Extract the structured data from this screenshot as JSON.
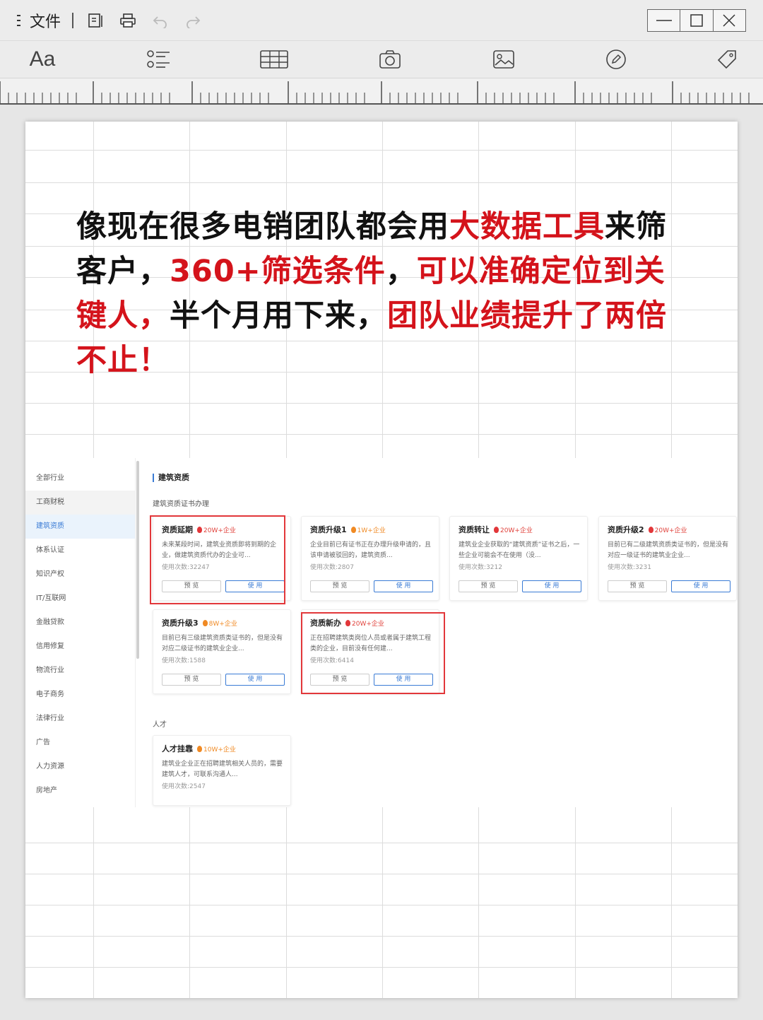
{
  "titlebar": {
    "menu_label": "文件"
  },
  "headline": {
    "l1a": "像现在很多电销团队都会用",
    "l1b": "大数据工具",
    "l1c": "来筛",
    "l2a": "客户，",
    "l2b": "360+筛选条件",
    "l2c": "，",
    "l2d": "可以准确定位到关",
    "l3a": "键人，",
    "l3b": "半个月用下来，",
    "l3c": "团队业绩提升了两倍",
    "l4a": "不止！"
  },
  "colors": {
    "accent_red": "#d4131b",
    "link_blue": "#3a7bd5",
    "tag_orange": "#f08a24",
    "highlight_box": "#e2373a"
  },
  "sidebar": {
    "items": [
      {
        "label": "全部行业"
      },
      {
        "label": "工商财税"
      },
      {
        "label": "建筑资质"
      },
      {
        "label": "体系认证"
      },
      {
        "label": "知识产权"
      },
      {
        "label": "IT/互联网"
      },
      {
        "label": "金融贷款"
      },
      {
        "label": "信用修复"
      },
      {
        "label": "物流行业"
      },
      {
        "label": "电子商务"
      },
      {
        "label": "法律行业"
      },
      {
        "label": "广告"
      },
      {
        "label": "人力资源"
      },
      {
        "label": "房地产"
      }
    ]
  },
  "section": {
    "title": "建筑资质",
    "sub1": "建筑资质证书办理",
    "sub2": "人才"
  },
  "cards": [
    {
      "title": "资质延期",
      "tag": "20W+企业",
      "desc": "未来某段时间，建筑业资质即将到期的企业，做建筑资质代办的企业可...",
      "use": "使用次数:32247",
      "preview": "预 览",
      "apply": "使 用"
    },
    {
      "title": "资质升级1",
      "tag": "1W+企业",
      "desc": "企业目前已有证书正在办理升级申请的，且该申请被驳回的，建筑资质...",
      "use": "使用次数:2807",
      "preview": "预 览",
      "apply": "使 用"
    },
    {
      "title": "资质转让",
      "tag": "20W+企业",
      "desc": "建筑业企业获取的“建筑资质”证书之后，一些企业可能会不在使用（没...",
      "use": "使用次数:3212",
      "preview": "预 览",
      "apply": "使 用"
    },
    {
      "title": "资质升级2",
      "tag": "20W+企业",
      "desc": "目前已有二级建筑资质类证书的，但是没有对应一级证书的建筑业企业...",
      "use": "使用次数:3231",
      "preview": "预 览",
      "apply": "使 用"
    },
    {
      "title": "资质升级3",
      "tag": "8W+企业",
      "desc": "目前已有三级建筑资质类证书的，但是没有对应二级证书的建筑业企业...",
      "use": "使用次数:1588",
      "preview": "预 览",
      "apply": "使 用"
    },
    {
      "title": "资质新办",
      "tag": "20W+企业",
      "desc": "正在招聘建筑类岗位人员或者属于建筑工程类的企业，目前没有任何建...",
      "use": "使用次数:6414",
      "preview": "预 览",
      "apply": "使 用"
    },
    {
      "title": "人才挂靠",
      "tag": "10W+企业",
      "desc": "建筑业企业正在招聘建筑相关人员的，需要建筑人才，可联系沟通人...",
      "use": "使用次数:2547",
      "preview": "",
      "apply": ""
    }
  ]
}
